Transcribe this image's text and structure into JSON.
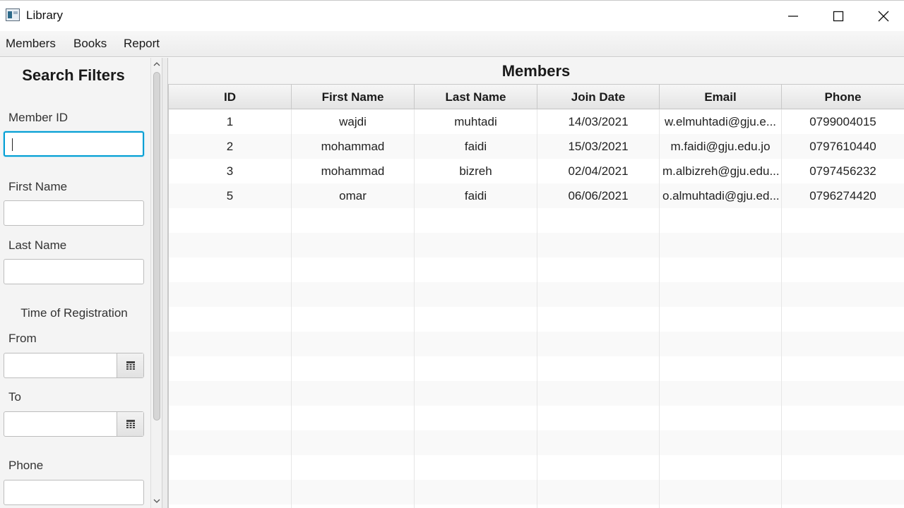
{
  "window": {
    "title": "Library",
    "icons": {
      "app": "library-app-icon",
      "minimize": "minimize-icon",
      "maximize": "maximize-icon",
      "close": "close-icon"
    }
  },
  "menu": {
    "items": [
      "Members",
      "Books",
      "Report"
    ]
  },
  "sidebar": {
    "heading": "Search Filters",
    "member_id_label": "Member ID",
    "member_id_value": "",
    "first_name_label": "First Name",
    "first_name_value": "",
    "last_name_label": "Last Name",
    "last_name_value": "",
    "registration_label": "Time of Registration",
    "from_label": "From",
    "from_value": "",
    "to_label": "To",
    "to_value": "",
    "phone_label": "Phone",
    "phone_value": "",
    "calendar_icon": "calendar-icon"
  },
  "main": {
    "title": "Members",
    "columns": [
      "ID",
      "First Name",
      "Last Name",
      "Join Date",
      "Email",
      "Phone"
    ],
    "rows": [
      [
        "1",
        "wajdi",
        "muhtadi",
        "14/03/2021",
        "w.elmuhtadi@gju.e...",
        "0799004015"
      ],
      [
        "2",
        "mohammad",
        "faidi",
        "15/03/2021",
        "m.faidi@gju.edu.jo",
        "0797610440"
      ],
      [
        "3",
        "mohammad",
        "bizreh",
        "02/04/2021",
        "m.albizreh@gju.edu...",
        "0797456232"
      ],
      [
        "5",
        "omar",
        "faidi",
        "06/06/2021",
        "o.almuhtadi@gju.ed...",
        "0796274420"
      ]
    ]
  },
  "colors": {
    "focus": "#039ed3",
    "panel": "#f4f4f4"
  }
}
